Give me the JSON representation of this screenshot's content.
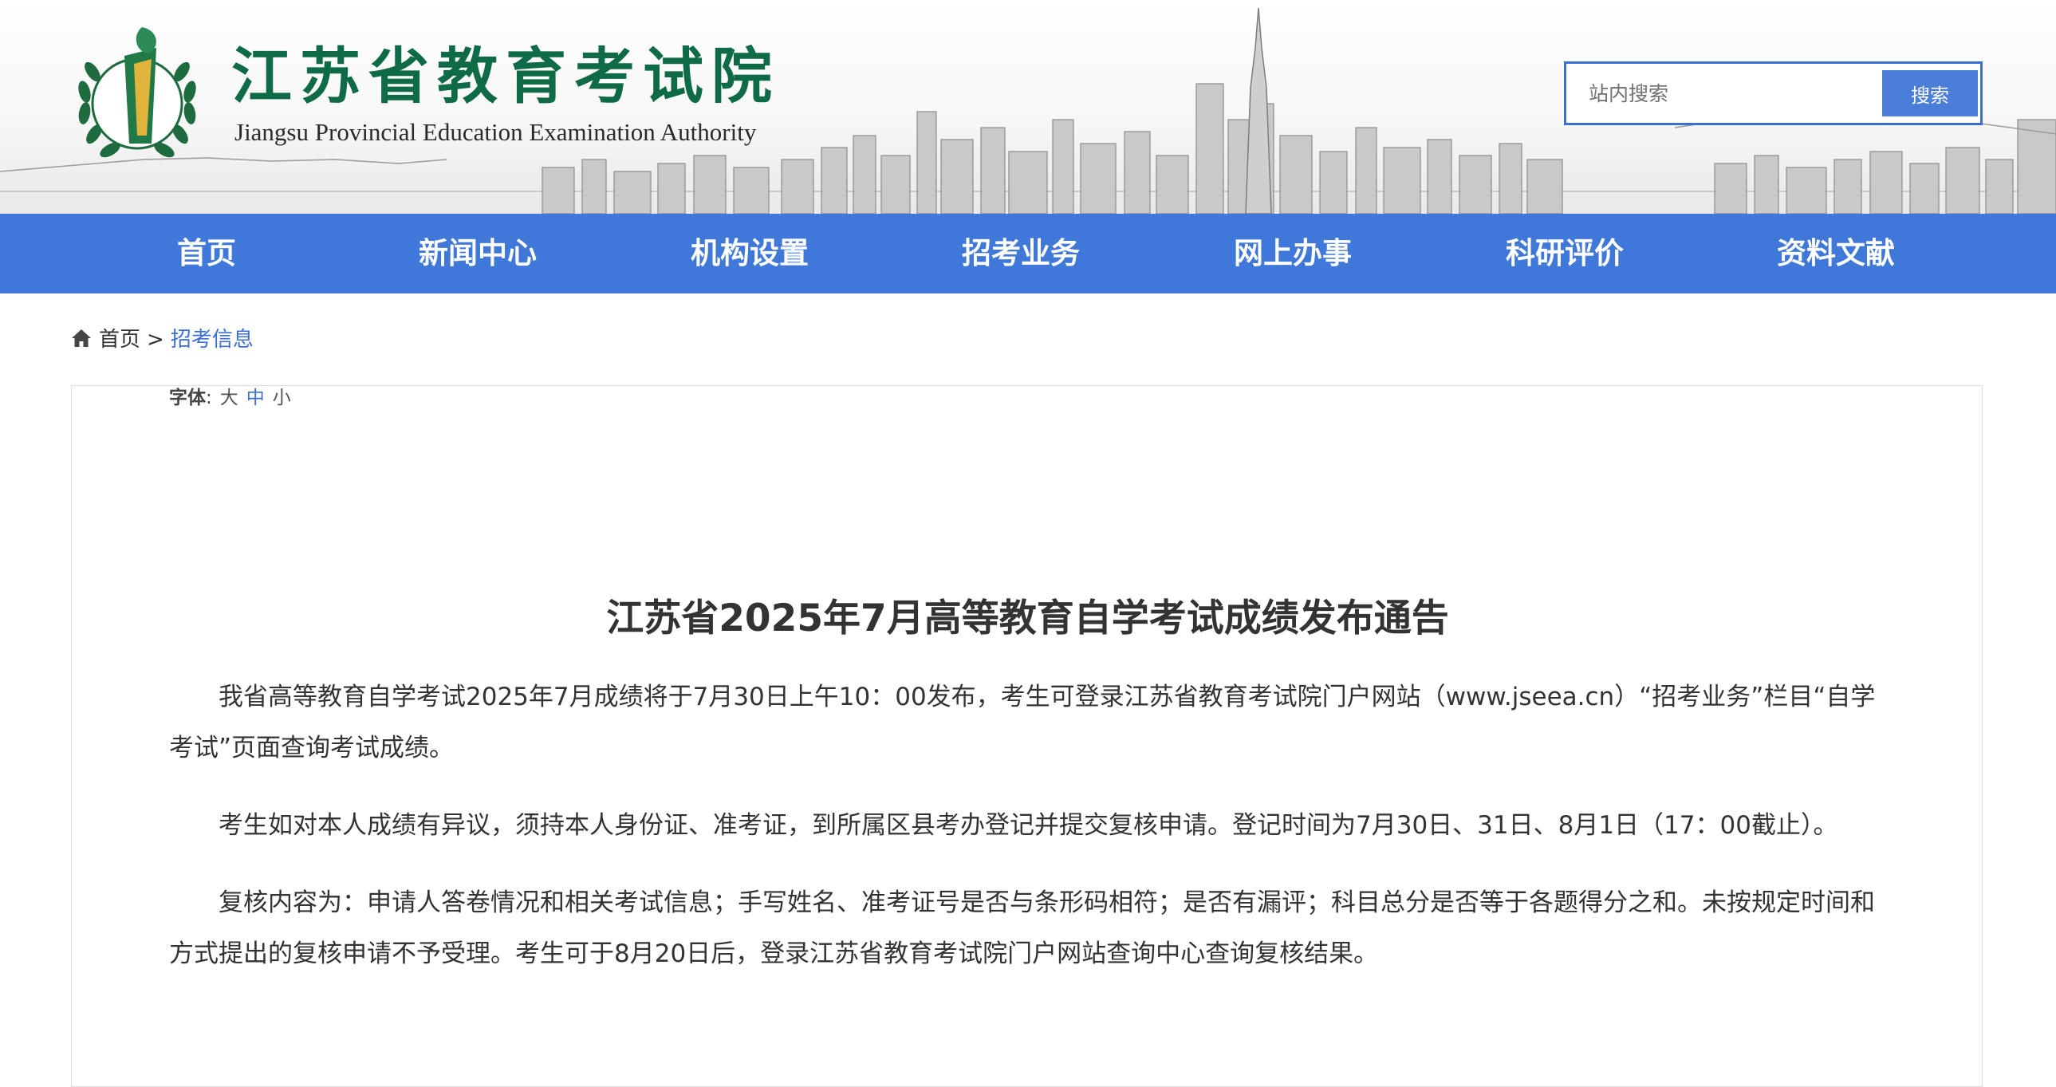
{
  "site": {
    "name_cn": "江苏省教育考试院",
    "name_en": "Jiangsu Provincial Education Examination Authority",
    "emblem_icon": "jseea-laurel-logo-icon"
  },
  "search": {
    "placeholder": "站内搜索",
    "button_label": "搜索"
  },
  "nav": {
    "items": [
      "首页",
      "新闻中心",
      "机构设置",
      "招考业务",
      "网上办事",
      "科研评价",
      "资料文献"
    ]
  },
  "breadcrumb": {
    "home_icon": "home-icon",
    "home": "首页",
    "separator": ">",
    "current": "招考信息"
  },
  "font_size": {
    "label": "字体",
    "colon": ":",
    "options": [
      "大",
      "中",
      "小"
    ],
    "active": "中"
  },
  "article": {
    "title": "江苏省2025年7月高等教育自学考试成绩发布通告",
    "paragraphs": [
      "我省高等教育自学考试2025年7月成绩将于7月30日上午10：00发布，考生可登录江苏省教育考试院门户网站（www.jseea.cn）“招考业务”栏目“自学考试”页面查询考试成绩。",
      "考生如对本人成绩有异议，须持本人身份证、准考证，到所属区县考办登记并提交复核申请。登记时间为7月30日、31日、8月1日（17：00截止）。",
      "复核内容为：申请人答卷情况和相关考试信息；手写姓名、准考证号是否与条形码相符；是否有漏评；科目总分是否等于各题得分之和。未按规定时间和方式提出的复核申请不予受理。考生可于8月20日后，登录江苏省教育考试院门户网站查询中心查询复核结果。"
    ]
  },
  "colors": {
    "nav_bg": "#4078d9",
    "accent_blue": "#3b6fd6",
    "logo_green": "#0f6b45",
    "text": "#333333"
  }
}
